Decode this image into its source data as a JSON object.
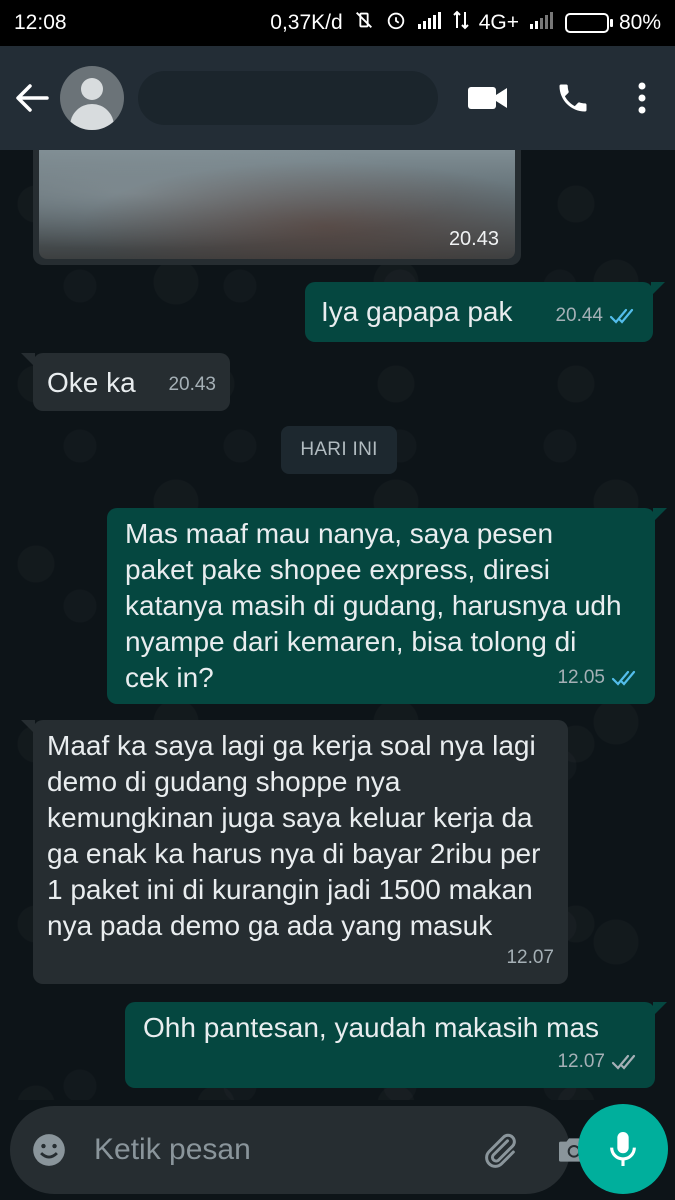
{
  "status_bar": {
    "time": "12:08",
    "speed": "0,37K/d",
    "network": "4G+",
    "battery": "80%",
    "battery_level": 0.8
  },
  "header": {
    "contact_name": "",
    "back_icon": "arrow-back-icon",
    "video_icon": "video-call-icon",
    "call_icon": "phone-icon",
    "menu_icon": "more-vert-icon"
  },
  "messages": [
    {
      "direction": "in",
      "type": "image",
      "time": "20.43"
    },
    {
      "direction": "out",
      "text": "Iya gapapa pak",
      "time": "20.44",
      "status": "read"
    },
    {
      "direction": "in",
      "text": "Oke ka",
      "time": "20.43"
    },
    {
      "direction": "out",
      "text": "Mas maaf mau nanya, saya pesen paket pake shopee express, diresi katanya masih di gudang, harusnya udh nyampe dari kemaren, bisa tolong di cek in?",
      "time": "12.05",
      "status": "read"
    },
    {
      "direction": "in",
      "text": "Maaf ka saya lagi ga kerja soal nya lagi demo di gudang shoppe nya kemungkinan juga saya keluar kerja da ga enak ka harus nya di bayar 2ribu per 1 paket ini di kurangin jadi 1500 makan nya pada demo ga ada yang masuk",
      "time": "12.07"
    },
    {
      "direction": "out",
      "text": "Ohh pantesan, yaudah makasih mas",
      "time": "12.07",
      "status": "delivered"
    }
  ],
  "date_divider": "HARI INI",
  "composer": {
    "placeholder": "Ketik pesan",
    "value": ""
  },
  "colors": {
    "incoming_bubble": "#262d31",
    "outgoing_bubble": "#054740",
    "accent": "#00af9c",
    "read_tick": "#53bdeb",
    "app_bar": "#232d36"
  }
}
